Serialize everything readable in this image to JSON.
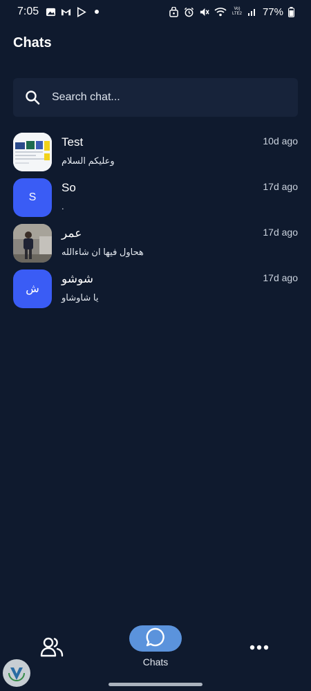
{
  "status_bar": {
    "time": "7:05",
    "battery": "77%",
    "network_label": "Vo) LTE2",
    "left_icons": [
      "photo-icon",
      "gmail-icon",
      "play-store-icon",
      "dot-icon"
    ],
    "right_icons": [
      "app-lock-icon",
      "alarm-icon",
      "mute-icon",
      "wifi-icon",
      "signal-icon",
      "battery-icon"
    ]
  },
  "header": {
    "title": "Chats"
  },
  "search": {
    "placeholder": "Search chat..."
  },
  "chats": [
    {
      "name": "Test",
      "preview": "وعليكم السلام",
      "time": "10d ago",
      "avatar_type": "image",
      "avatar_letter": ""
    },
    {
      "name": "So",
      "preview": ".",
      "time": "17d ago",
      "avatar_type": "letter",
      "avatar_letter": "S"
    },
    {
      "name": "عمر",
      "preview": "هحاول فيها  ان شاءالله",
      "time": "17d ago",
      "avatar_type": "image",
      "avatar_letter": ""
    },
    {
      "name": "شوشو",
      "preview": "يا شاوشاو",
      "time": "17d ago",
      "avatar_type": "letter",
      "avatar_letter": "ش"
    }
  ],
  "bottom_nav": {
    "contacts_icon": "contacts-icon",
    "chats_label": "Chats",
    "more_icon": "more-icon"
  },
  "colors": {
    "background": "#0f1a2e",
    "search_bg": "#17233a",
    "avatar_accent": "#3a5cf5",
    "active_tab": "#5b93dc"
  }
}
